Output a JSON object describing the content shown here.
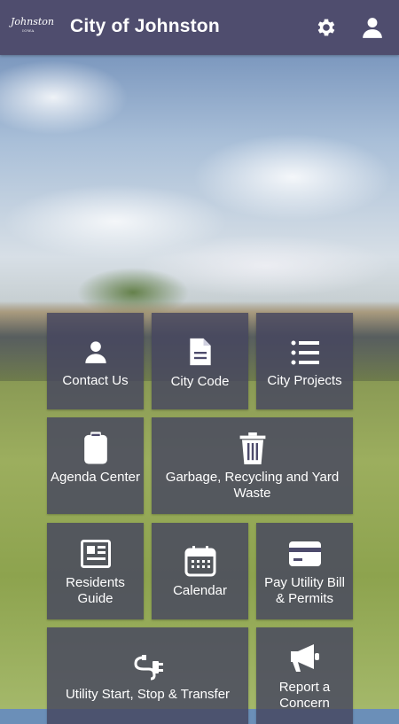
{
  "header": {
    "logo_text": "Johnston",
    "logo_sub": "IOWA",
    "title": "City of Johnston",
    "settings_icon": "gear-icon",
    "account_icon": "user-icon",
    "color": "#4f4d6e"
  },
  "tiles": [
    {
      "label": "Contact Us",
      "icon": "person-icon"
    },
    {
      "label": "City Code",
      "icon": "document-icon"
    },
    {
      "label": "City Projects",
      "icon": "list-icon"
    },
    {
      "label": "Agenda Center",
      "icon": "clipboard-icon"
    },
    {
      "label": "Garbage, Recycling and Yard Waste",
      "icon": "trash-icon"
    },
    {
      "label": "Residents Guide",
      "icon": "newspaper-icon"
    },
    {
      "label": "Calendar",
      "icon": "calendar-icon"
    },
    {
      "label": "Pay Utility Bill & Permits",
      "icon": "credit-card-icon"
    },
    {
      "label": "Utility Start, Stop & Transfer",
      "icon": "plug-icon"
    },
    {
      "label": "Report a Concern",
      "icon": "megaphone-icon"
    }
  ]
}
